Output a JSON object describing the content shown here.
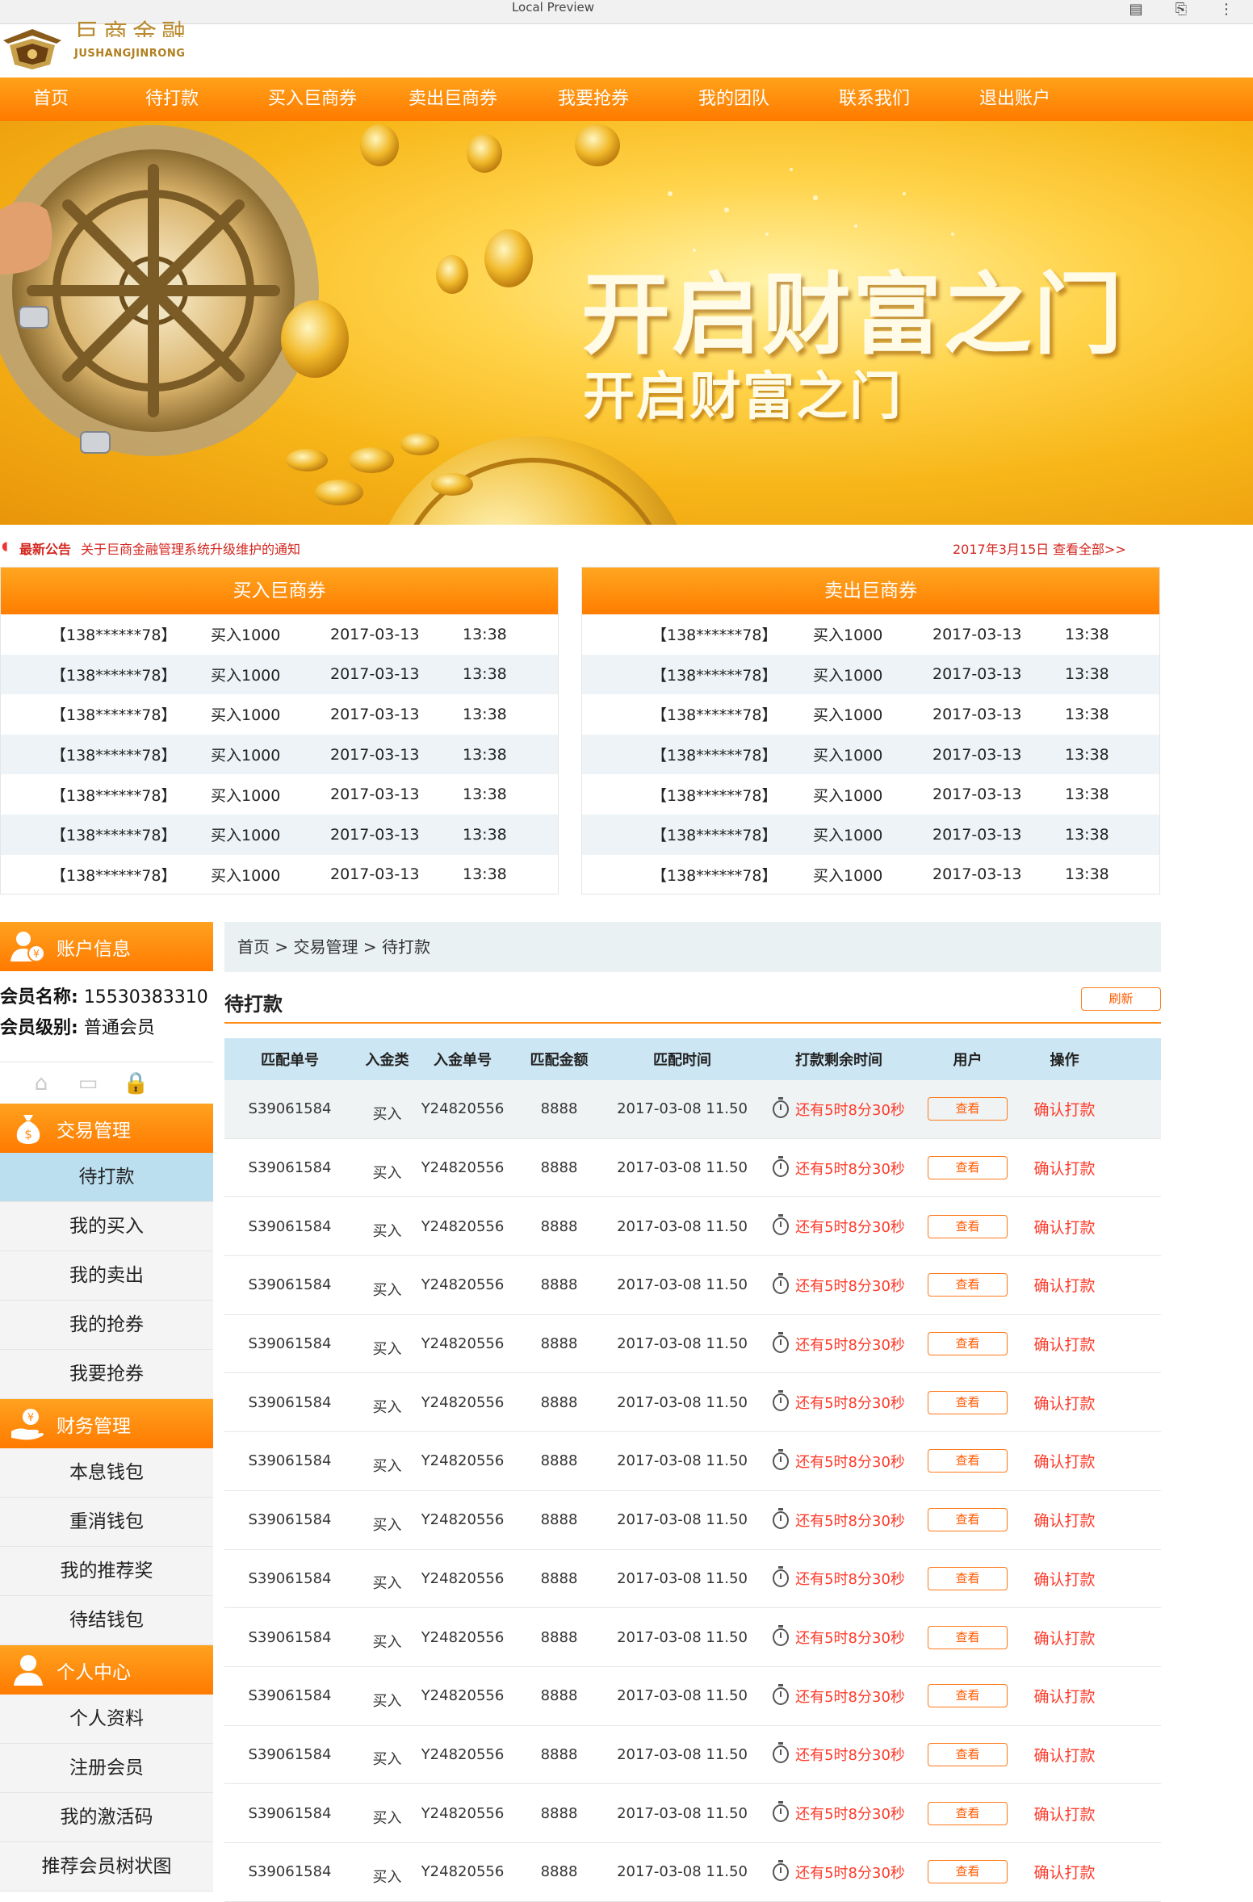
{
  "browser": {
    "title": "Local Preview"
  },
  "header": {
    "logo_cn": "巨商金融",
    "logo_en": "JUSHANGJINRONG"
  },
  "nav": [
    "首页",
    "待打款",
    "买入巨商券",
    "卖出巨商券",
    "我要抢券",
    "我的团队",
    "联系我们",
    "退出账户"
  ],
  "banner": {
    "headline": "开启财富之门",
    "subline": "开启财富之门"
  },
  "notice": {
    "label": "最新公告",
    "text": "关于巨商金融管理系统升级维护的通知",
    "date": "2017年3月15日",
    "more": "查看全部>>"
  },
  "boards": {
    "buy": {
      "title": "买入巨商券",
      "rows": [
        [
          "【138******78】",
          "买入1000",
          "2017-03-13",
          "13:38"
        ],
        [
          "【138******78】",
          "买入1000",
          "2017-03-13",
          "13:38"
        ],
        [
          "【138******78】",
          "买入1000",
          "2017-03-13",
          "13:38"
        ],
        [
          "【138******78】",
          "买入1000",
          "2017-03-13",
          "13:38"
        ],
        [
          "【138******78】",
          "买入1000",
          "2017-03-13",
          "13:38"
        ],
        [
          "【138******78】",
          "买入1000",
          "2017-03-13",
          "13:38"
        ],
        [
          "【138******78】",
          "买入1000",
          "2017-03-13",
          "13:38"
        ]
      ]
    },
    "sell": {
      "title": "卖出巨商券",
      "rows": [
        [
          "【138******78】",
          "买入1000",
          "2017-03-13",
          "13:38"
        ],
        [
          "【138******78】",
          "买入1000",
          "2017-03-13",
          "13:38"
        ],
        [
          "【138******78】",
          "买入1000",
          "2017-03-13",
          "13:38"
        ],
        [
          "【138******78】",
          "买入1000",
          "2017-03-13",
          "13:38"
        ],
        [
          "【138******78】",
          "买入1000",
          "2017-03-13",
          "13:38"
        ],
        [
          "【138******78】",
          "买入1000",
          "2017-03-13",
          "13:38"
        ],
        [
          "【138******78】",
          "买入1000",
          "2017-03-13",
          "13:38"
        ]
      ]
    }
  },
  "sidebar": {
    "account_header": "账户信息",
    "member_name_label": "会员名称:",
    "member_name": "15530383310",
    "member_level_label": "会员级别:",
    "member_level": "普通会员",
    "sections": [
      {
        "title": "交易管理",
        "icon": "money-bag-icon",
        "items": [
          "待打款",
          "我的买入",
          "我的卖出",
          "我的抢券",
          "我要抢券"
        ]
      },
      {
        "title": "财务管理",
        "icon": "hand-coin-icon",
        "items": [
          "本息钱包",
          "重消钱包",
          "我的推荐奖",
          "待结钱包"
        ]
      },
      {
        "title": "个人中心",
        "icon": "person-icon",
        "items": [
          "个人资料",
          "注册会员",
          "我的激活码",
          "推荐会员树状图"
        ]
      }
    ],
    "active_item": "待打款"
  },
  "main": {
    "breadcrumb": "首页 > 交易管理 > 待打款",
    "section_title": "待打款",
    "refresh_label": "刷新",
    "columns": [
      "匹配单号",
      "入金类",
      "入金单号",
      "匹配金额",
      "匹配时间",
      "打款剩余时间",
      "用户",
      "操作"
    ],
    "rows": [
      {
        "match_no": "S39061584",
        "type": "买入",
        "order_no": "Y24820556",
        "amount": "8888",
        "time": "2017-03-08 11.50",
        "remaining": "还有5时8分30秒",
        "user_btn": "查看",
        "action": "确认打款"
      },
      {
        "match_no": "S39061584",
        "type": "买入",
        "order_no": "Y24820556",
        "amount": "8888",
        "time": "2017-03-08 11.50",
        "remaining": "还有5时8分30秒",
        "user_btn": "查看",
        "action": "确认打款"
      },
      {
        "match_no": "S39061584",
        "type": "买入",
        "order_no": "Y24820556",
        "amount": "8888",
        "time": "2017-03-08 11.50",
        "remaining": "还有5时8分30秒",
        "user_btn": "查看",
        "action": "确认打款"
      },
      {
        "match_no": "S39061584",
        "type": "买入",
        "order_no": "Y24820556",
        "amount": "8888",
        "time": "2017-03-08 11.50",
        "remaining": "还有5时8分30秒",
        "user_btn": "查看",
        "action": "确认打款"
      },
      {
        "match_no": "S39061584",
        "type": "买入",
        "order_no": "Y24820556",
        "amount": "8888",
        "time": "2017-03-08 11.50",
        "remaining": "还有5时8分30秒",
        "user_btn": "查看",
        "action": "确认打款"
      },
      {
        "match_no": "S39061584",
        "type": "买入",
        "order_no": "Y24820556",
        "amount": "8888",
        "time": "2017-03-08 11.50",
        "remaining": "还有5时8分30秒",
        "user_btn": "查看",
        "action": "确认打款"
      },
      {
        "match_no": "S39061584",
        "type": "买入",
        "order_no": "Y24820556",
        "amount": "8888",
        "time": "2017-03-08 11.50",
        "remaining": "还有5时8分30秒",
        "user_btn": "查看",
        "action": "确认打款"
      },
      {
        "match_no": "S39061584",
        "type": "买入",
        "order_no": "Y24820556",
        "amount": "8888",
        "time": "2017-03-08 11.50",
        "remaining": "还有5时8分30秒",
        "user_btn": "查看",
        "action": "确认打款"
      },
      {
        "match_no": "S39061584",
        "type": "买入",
        "order_no": "Y24820556",
        "amount": "8888",
        "time": "2017-03-08 11.50",
        "remaining": "还有5时8分30秒",
        "user_btn": "查看",
        "action": "确认打款"
      },
      {
        "match_no": "S39061584",
        "type": "买入",
        "order_no": "Y24820556",
        "amount": "8888",
        "time": "2017-03-08 11.50",
        "remaining": "还有5时8分30秒",
        "user_btn": "查看",
        "action": "确认打款"
      },
      {
        "match_no": "S39061584",
        "type": "买入",
        "order_no": "Y24820556",
        "amount": "8888",
        "time": "2017-03-08 11.50",
        "remaining": "还有5时8分30秒",
        "user_btn": "查看",
        "action": "确认打款"
      },
      {
        "match_no": "S39061584",
        "type": "买入",
        "order_no": "Y24820556",
        "amount": "8888",
        "time": "2017-03-08 11.50",
        "remaining": "还有5时8分30秒",
        "user_btn": "查看",
        "action": "确认打款"
      },
      {
        "match_no": "S39061584",
        "type": "买入",
        "order_no": "Y24820556",
        "amount": "8888",
        "time": "2017-03-08 11.50",
        "remaining": "还有5时8分30秒",
        "user_btn": "查看",
        "action": "确认打款"
      },
      {
        "match_no": "S39061584",
        "type": "买入",
        "order_no": "Y24820556",
        "amount": "8888",
        "time": "2017-03-08 11.50",
        "remaining": "还有5时8分30秒",
        "user_btn": "查看",
        "action": "确认打款"
      }
    ]
  },
  "colors": {
    "accent": "#ff8200",
    "alert": "#ff3a2a",
    "crumb_bg": "#eaf1f3",
    "active_item": "#bcdff0"
  }
}
